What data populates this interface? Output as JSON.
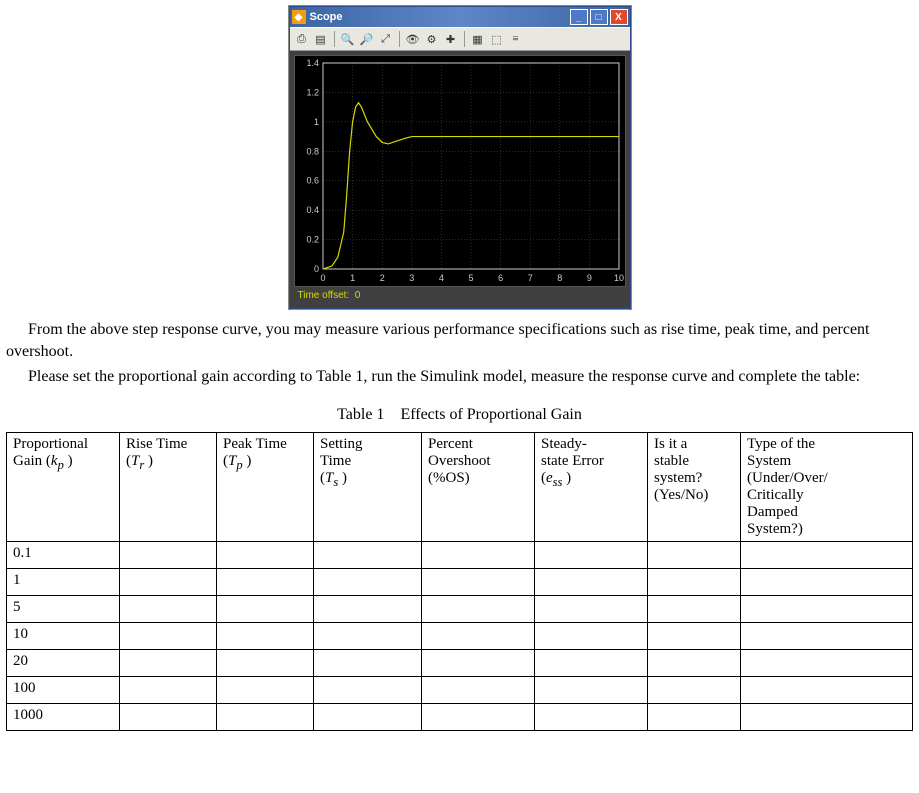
{
  "scope": {
    "title": "Scope",
    "time_offset_label": "Time offset:",
    "time_offset_value": "0",
    "toolbar_icons": [
      "print-icon",
      "page-icon",
      "zoom-in-icon",
      "zoom-out-icon",
      "zoom-icon",
      "autoscale-icon",
      "settings-icon",
      "axes-icon",
      "params-icon",
      "float-icon",
      "dock-icon"
    ]
  },
  "paragraphs": {
    "p1": "From the above step response curve, you may measure various performance specifications such as rise time, peak time, and percent overshoot.",
    "p2": "Please set the proportional gain according to Table 1, run the Simulink model, measure the response curve and complete the table:"
  },
  "table": {
    "caption_label": "Table 1",
    "caption_title": "Effects of Proportional Gain",
    "headers": {
      "c0_a": "Proportional",
      "c0_b": "Gain (",
      "c0_sym": "k",
      "c0_sub": "p",
      "c0_close": " )",
      "c1": "Rise Time",
      "c1_sym": "T",
      "c1_sub": "r",
      "c2": "Peak Time",
      "c2_sym": "T",
      "c2_sub": "p",
      "c3_a": "Setting",
      "c3_b": "Time",
      "c3_sym": "T",
      "c3_sub": "s",
      "c4_a": "Percent",
      "c4_b": "Overshoot",
      "c4_c": "(%OS)",
      "c5_a": "Steady-",
      "c5_b": "state Error",
      "c5_sym": "e",
      "c5_sub": "ss",
      "c6_a": "Is it a",
      "c6_b": "stable",
      "c6_c": "system?",
      "c6_d": "(Yes/No)",
      "c7_a": "Type of the",
      "c7_b": "System",
      "c7_c": "(Under/Over/",
      "c7_d": "Critically",
      "c7_e": "Damped",
      "c7_f": "System?)"
    },
    "rows": [
      "0.1",
      "1",
      "5",
      "10",
      "20",
      "100",
      "1000"
    ]
  },
  "chart_data": {
    "type": "line",
    "title": "",
    "xlabel": "",
    "ylabel": "",
    "xlim": [
      0,
      10
    ],
    "ylim": [
      0,
      1.4
    ],
    "x_ticks": [
      0,
      1,
      2,
      3,
      4,
      5,
      6,
      7,
      8,
      9,
      10
    ],
    "y_ticks": [
      0,
      0.2,
      0.4,
      0.6,
      0.8,
      1.0,
      1.2,
      1.4
    ],
    "series": [
      {
        "name": "step response",
        "color": "#d8d800",
        "x": [
          0.0,
          0.3,
          0.5,
          0.7,
          0.8,
          0.9,
          1.0,
          1.1,
          1.2,
          1.3,
          1.5,
          1.8,
          2.0,
          2.2,
          2.5,
          2.8,
          3.0,
          3.5,
          4.0,
          5.0,
          6.0,
          10.0
        ],
        "y": [
          0.0,
          0.02,
          0.08,
          0.25,
          0.5,
          0.8,
          1.0,
          1.1,
          1.13,
          1.1,
          1.0,
          0.9,
          0.86,
          0.85,
          0.87,
          0.89,
          0.9,
          0.9,
          0.9,
          0.9,
          0.9,
          0.9
        ]
      }
    ]
  }
}
